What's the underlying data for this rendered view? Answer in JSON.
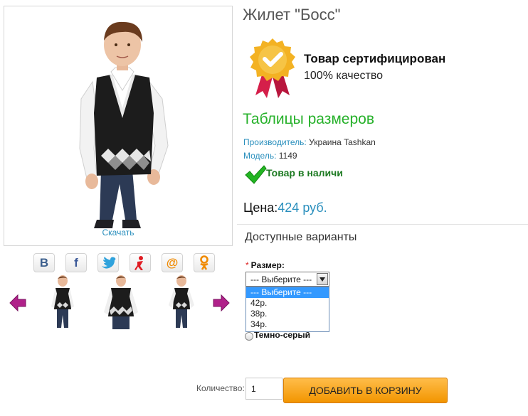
{
  "product": {
    "title": "Жилет \"Босс\"",
    "download_link": "Скачать",
    "main_image_icon": "boy-in-vest-photo"
  },
  "share": [
    {
      "name": "vkontakte",
      "glyph": "В",
      "color": "#3b5e8c"
    },
    {
      "name": "facebook",
      "glyph": "f",
      "color": "#3b5998"
    },
    {
      "name": "twitter",
      "glyph": "bird",
      "color": "#2fa2dc"
    },
    {
      "name": "moi-krug",
      "glyph": "person",
      "color": "#e01b22"
    },
    {
      "name": "mail-ru",
      "glyph": "@",
      "color": "#f08a00"
    },
    {
      "name": "odnoklassniki",
      "glyph": "ok",
      "color": "#f08a00"
    }
  ],
  "thumbnails": {
    "prev_icon": "arrow-left-icon",
    "next_icon": "arrow-right-icon",
    "items": [
      "thumb-front-boy",
      "thumb-vest-only",
      "thumb-side-boy"
    ]
  },
  "certificate": {
    "title": "Товар сертифицирован",
    "subtitle": "100% качество",
    "icon": "award-badge-icon"
  },
  "size_tables_link": "Таблицы размеров",
  "meta": {
    "maker_key": "Производитель:",
    "maker_value": "Украина Tashkan",
    "model_key": "Модель:",
    "model_value": "1149"
  },
  "stock": {
    "text": "Товар в наличи",
    "icon": "check-icon"
  },
  "price": {
    "label": "Цена:",
    "value": "424 руб."
  },
  "variants": {
    "title": "Доступные варианты",
    "required_mark": "*",
    "size_label": "Размер:",
    "selected": "--- Выберите ---",
    "options": [
      "--- Выберите ---",
      "42р.",
      "38р.",
      "34р."
    ],
    "color_option": "Темно-серый"
  },
  "cart": {
    "qty_label": "Количество:",
    "qty_value": "1",
    "button_label": "ДОБАВИТЬ В КОРЗИНУ"
  },
  "colors": {
    "accent_green": "#26b12a",
    "link_blue": "#2a8fbd",
    "button_orange": "#f29500",
    "badge_gold": "#f3b223",
    "badge_ribbon": "#d51f4a",
    "arrow_purple": "#b0218a"
  }
}
